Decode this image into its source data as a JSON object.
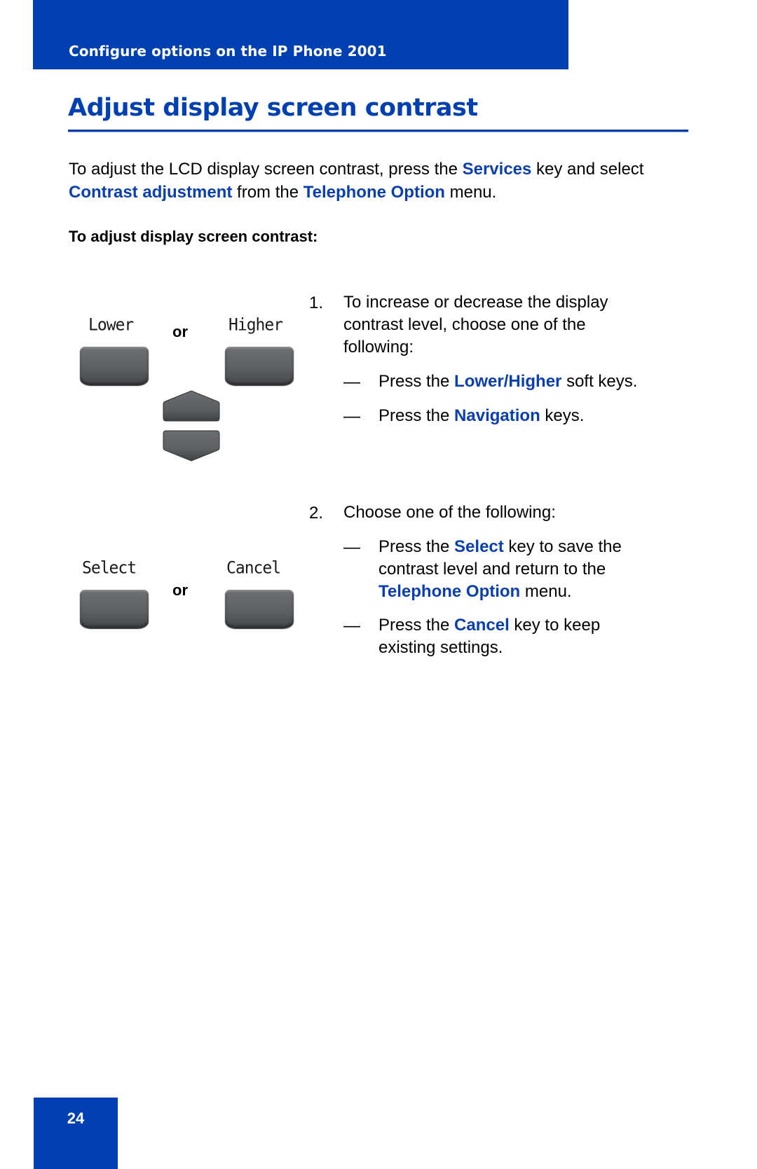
{
  "header": {
    "section_title": "Configure options on the IP Phone 2001"
  },
  "page_title": "Adjust display screen contrast",
  "intro": {
    "t1": "To adjust the LCD display screen contrast, press the ",
    "services": "Services",
    "t2": " key and select ",
    "contrast_adjustment": "Contrast adjustment",
    "t3": " from the ",
    "telephone_option": "Telephone Option",
    "t4": " menu."
  },
  "procedure_heading": "To adjust display screen contrast:",
  "keys": {
    "lower": "Lower",
    "higher": "Higher",
    "select": "Select",
    "cancel": "Cancel",
    "or": "or"
  },
  "steps": [
    {
      "number": "1.",
      "text": "To increase or decrease the display contrast level, choose one of the following:",
      "options": [
        {
          "dash": "—",
          "pre": "Press the ",
          "key": "Lower/Higher",
          "post": " soft keys."
        },
        {
          "dash": "—",
          "pre": "Press the ",
          "key": "Navigation",
          "post": " keys."
        }
      ]
    },
    {
      "number": "2.",
      "text": "Choose one of the following:",
      "options": [
        {
          "dash": "—",
          "pre": "Press the ",
          "key": "Select",
          "post": " key to save the contrast level and return to the ",
          "key2": "Telephone Option",
          "post2": " menu."
        },
        {
          "dash": "—",
          "pre": "Press the ",
          "key": "Cancel",
          "post": " key to keep existing settings."
        }
      ]
    }
  ],
  "page_number": "24",
  "colors": {
    "brand_blue": "#0040B0",
    "highlight_blue": "#0A3FB0",
    "key_gray": "#5d6063"
  }
}
